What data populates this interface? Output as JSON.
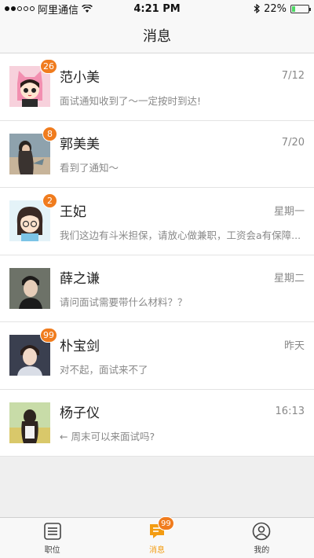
{
  "status_bar": {
    "carrier": "阿里通信",
    "time": "4:21 PM",
    "battery": "22%"
  },
  "header": {
    "title": "消息"
  },
  "messages": [
    {
      "name": "范小美",
      "time": "7/12",
      "preview": "面试通知收到了～一定按时到达!",
      "badge": "26"
    },
    {
      "name": "郭美美",
      "time": "7/20",
      "preview": "看到了通知～",
      "badge": "8"
    },
    {
      "name": "王妃",
      "time": "星期一",
      "preview": "我们这边有斗米担保，请放心做兼职，工资会a有保障...",
      "badge": "2"
    },
    {
      "name": "薛之谦",
      "time": "星期二",
      "preview": "请问面试需要带什么材料？？",
      "badge": ""
    },
    {
      "name": "朴宝剑",
      "time": "昨天",
      "preview": "对不起，面试来不了",
      "badge": "99"
    },
    {
      "name": "杨子仪",
      "time": "16:13",
      "preview": "← 周末可以来面试吗?",
      "badge": ""
    }
  ],
  "tabbar": {
    "tabs": [
      {
        "label": "职位",
        "icon": "list-icon"
      },
      {
        "label": "消息",
        "icon": "chat-icon",
        "badge": "99"
      },
      {
        "label": "我的",
        "icon": "profile-icon"
      }
    ]
  },
  "colors": {
    "accent": "#f07c1e",
    "active_tab": "#f39c12"
  }
}
